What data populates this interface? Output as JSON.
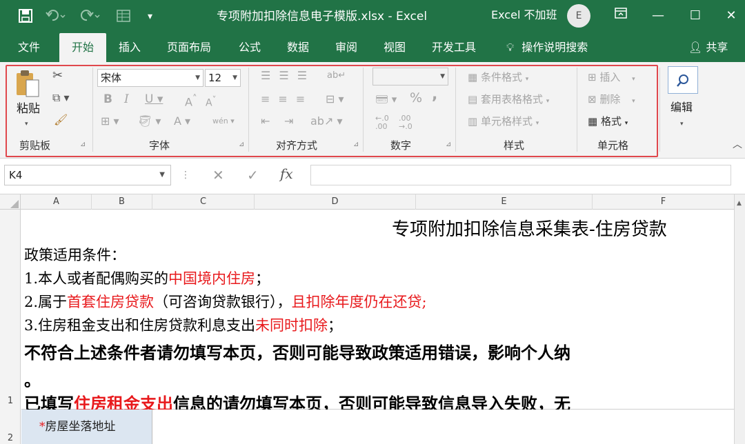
{
  "titlebar": {
    "save_icon": "save-icon",
    "undo_icon": "undo-icon",
    "redo_icon": "redo-icon",
    "form_icon": "form-icon",
    "title": "专项附加扣除信息电子模版.xlsx  -  Excel",
    "account": "Excel 不加班",
    "avatar": "E",
    "restore_icon": "ribbon-display-icon",
    "minimize": "—",
    "maximize": "☐",
    "close": "✕"
  },
  "tabs": [
    "文件",
    "开始",
    "插入",
    "页面布局",
    "公式",
    "数据",
    "审阅",
    "视图",
    "开发工具"
  ],
  "search": {
    "icon": "lightbulb-icon",
    "label": "操作说明搜索"
  },
  "share": {
    "icon": "person-add-icon",
    "label": "共享"
  },
  "ribbon": {
    "clipboard": {
      "label": "剪贴板",
      "paste": "粘贴"
    },
    "font": {
      "label": "字体",
      "font_name": "宋体",
      "font_size": "12"
    },
    "alignment": {
      "label": "对齐方式"
    },
    "number": {
      "label": "数字",
      "percent": "%",
      "comma": ","
    },
    "styles": {
      "label": "样式",
      "conditional": "条件格式",
      "table": "套用表格格式",
      "cell_styles": "单元格样式"
    },
    "cells": {
      "label": "单元格",
      "insert": "插入",
      "delete": "删除",
      "format": "格式"
    },
    "editing": {
      "label": "编辑"
    }
  },
  "formula_bar": {
    "name_box": "K4",
    "fx": "fx",
    "formula": ""
  },
  "columns": [
    "A",
    "B",
    "C",
    "D",
    "E",
    "F"
  ],
  "rows": [
    "1",
    "2"
  ],
  "cell_A1": {
    "heading": "专项附加扣除信息采集表-住房贷款",
    "l1": "政策适用条件：",
    "l2a": "1.本人或者配偶购买的",
    "l2b": "中国境内住房",
    "l2c": "；",
    "l3a": "2.属于",
    "l3b": "首套住房贷款",
    "l3c": "（可咨询贷款银行），",
    "l3d": "且扣除年度仍在还贷;",
    "l4a": "3.住房租金支出和住房贷款利息支出",
    "l4b": "未同时扣除",
    "l4c": "；",
    "l5": "不符合上述条件者请勿填写本页，否则可能导致政策适用错误，影响个人纳",
    "l6": "。",
    "l7a": "已填写",
    "l7b": "住房租金支出",
    "l7c": "信息的请勿填写本页，否则可能导致信息导入失败，无"
  },
  "cell_A2": {
    "mark": "*",
    "text": "房屋坐落地址"
  },
  "colors": {
    "accent": "#217346",
    "red": "#e8191c",
    "highlight": "#e0474c",
    "cell_fill": "#dce6f1"
  }
}
